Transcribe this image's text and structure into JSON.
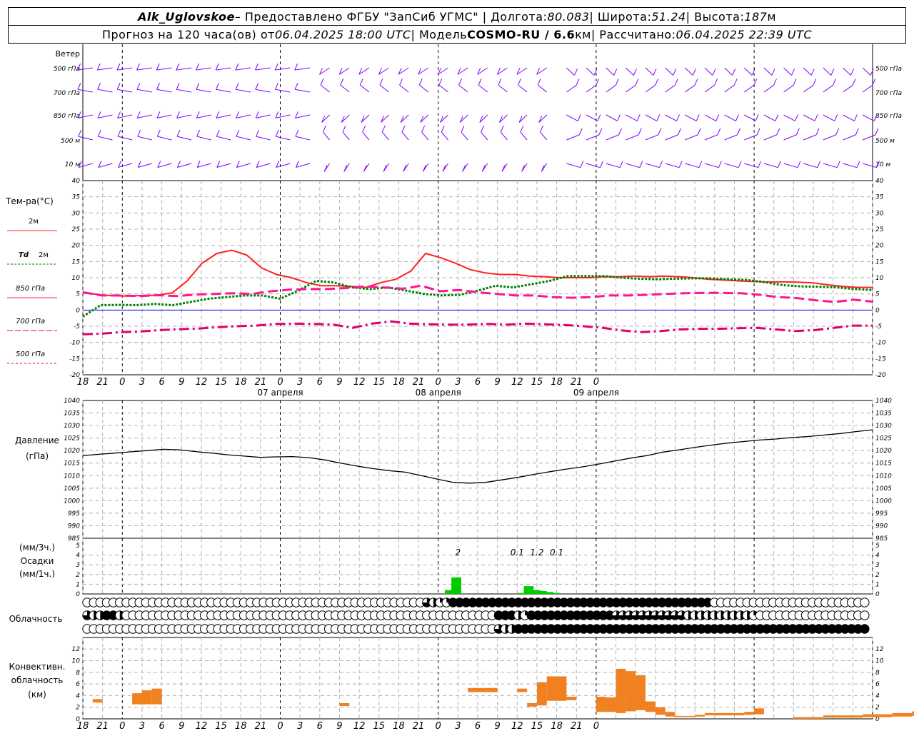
{
  "header": {
    "station": "Alk_Uglovskoe",
    "provider": " – Предоставлено ФГБУ \"ЗапСиб УГМС\" | Долгота: ",
    "lon": "80.083",
    "lat_label": " | Широта: ",
    "lat": "51.24",
    "alt_label": " | Высота: ",
    "alt": "187",
    "alt_unit": "м",
    "forecast_label": "Прогноз на 120 часа(ов) от ",
    "forecast_start": "06.04.2025 18:00 UTC",
    "model_label": "  | Модель ",
    "model": "COSMO-RU / 6.6",
    "model_unit": "км",
    "computed_label": " | Рассчитано: ",
    "computed": "06.04.2025 22:39 UTC"
  },
  "labels": {
    "wind": "Ветер",
    "wind_levels": [
      "500 гПа",
      "700 гПа",
      "850 гПа",
      "500 м",
      "10  м"
    ],
    "temp": "Тем-ра(°C)",
    "t2m": "2м",
    "td": "Td",
    "td2": "2м",
    "t850": "850 гПа",
    "t700": "700 гПа",
    "t500": "500 гПа",
    "pressure": "Давление",
    "pressure_unit": "(гПа)",
    "precip_unit3": "(мм/3ч.)",
    "precip": "Осадки",
    "precip_unit1": "(мм/1ч.)",
    "cloud": "Облачность",
    "conv1": "Конвективн.",
    "conv2": "облачность",
    "conv3": "(км)"
  },
  "time_axis": {
    "ticks": [
      "18",
      "21",
      "0",
      "3",
      "6",
      "9",
      "12",
      "15",
      "18",
      "21",
      "0",
      "3",
      "6",
      "9",
      "12",
      "15",
      "18",
      "21",
      "0",
      "3",
      "6",
      "9",
      "12",
      "15",
      "18",
      "21",
      "0"
    ],
    "dates": [
      "07 апреля",
      "08 апреля",
      "09 апреля"
    ]
  },
  "colors": {
    "wind": "#8000ff",
    "t2m": "#ff2020",
    "td": "#008000",
    "t850": "#ff1493",
    "t700": "#e0006a",
    "zero": "#0000ff",
    "precip": "#00cc00",
    "conv": "#f08020",
    "grid": "#b0b0b0"
  },
  "chart_data": [
    {
      "type": "line",
      "title": "Тем-ра(°C)",
      "x_hours": [
        0,
        3,
        6,
        9,
        12,
        15,
        18,
        21,
        24,
        27,
        30,
        33,
        36,
        39,
        42,
        45,
        48,
        51,
        54,
        57,
        60,
        63,
        66,
        69,
        72,
        75,
        78,
        81,
        84,
        87,
        90,
        93,
        96,
        99,
        102,
        105,
        108,
        111,
        114,
        117,
        120
      ],
      "ylim": [
        -20,
        40
      ],
      "series": [
        {
          "name": "2м",
          "values": [
            5.5,
            4.8,
            4.4,
            4.3,
            4.5,
            4.6,
            5.3,
            9,
            14.5,
            17.5,
            18.5,
            17,
            13,
            11,
            10,
            8.5,
            7.5,
            7.5,
            7.3,
            7,
            8.5,
            9.5,
            12,
            17.5,
            16.2,
            14.5,
            12.5,
            11.5,
            11,
            11,
            10.5,
            10.3,
            10,
            10,
            10,
            10.3,
            10.3,
            10.5,
            10.3,
            10.5,
            10.3,
            10,
            9.5,
            9.3,
            9,
            8.8,
            8.7,
            8.7,
            8.6,
            8.4,
            7.8,
            7.3,
            7,
            7
          ]
        },
        {
          "name": "Td 2м",
          "values": [
            -2,
            1.5,
            1.6,
            1.5,
            1.9,
            1.5,
            2.5,
            3.5,
            4,
            4.5,
            4.5,
            3.5,
            6,
            9,
            8.5,
            7,
            6.5,
            7,
            6,
            5,
            4.5,
            4.7,
            6,
            7.5,
            7,
            8,
            9,
            10.5,
            10.5,
            10.5,
            10,
            9.7,
            9.5,
            9.7,
            9.8,
            9.8,
            9.5,
            9.3,
            8.6,
            7.7,
            7.3,
            7.2,
            7,
            6.5,
            6.2
          ]
        },
        {
          "name": "850 гПа",
          "values": [
            5.5,
            4.5,
            4.5,
            4.3,
            4.6,
            4.3,
            4.8,
            5,
            5.2,
            5,
            5.8,
            6.3,
            6.5,
            6.5,
            6.8,
            7.3,
            7,
            6.6,
            7.5,
            5.8,
            6.2,
            5.5,
            5,
            4.5,
            4.5,
            4,
            3.8,
            4,
            4.5,
            4.5,
            4.7,
            5,
            5.2,
            5.3,
            5.3,
            5.2,
            4.7,
            4,
            3.7,
            3,
            2.5,
            3.2,
            2.6
          ]
        },
        {
          "name": "700 гПа",
          "values": [
            -7.5,
            -7.3,
            -6.8,
            -6.6,
            -6.2,
            -5.9,
            -5.7,
            -5.3,
            -5,
            -4.8,
            -4.3,
            -4.2,
            -4.3,
            -4.5,
            -5.5,
            -4.2,
            -3.5,
            -4.2,
            -4.4,
            -4.5,
            -4.5,
            -4.3,
            -4.5,
            -4.2,
            -4.4,
            -4.6,
            -5,
            -5.5,
            -6.3,
            -6.8,
            -6.5,
            -6,
            -5.8,
            -5.8,
            -5.6,
            -5.5,
            -6,
            -6.5,
            -6.2,
            -5.5,
            -4.8,
            -4.8
          ]
        }
      ]
    },
    {
      "type": "line",
      "title": "Давление",
      "ylabel": "(гПа)",
      "ylim": [
        985,
        1040
      ],
      "series": [
        {
          "name": "Давление",
          "values": [
            1018,
            1018.5,
            1019,
            1019.5,
            1020,
            1020.5,
            1020.3,
            1019.6,
            1019,
            1018.3,
            1017.8,
            1017.3,
            1017.5,
            1017.6,
            1017.2,
            1016.3,
            1015,
            1013.8,
            1012.8,
            1012,
            1011.4,
            1010,
            1008.6,
            1007.3,
            1007,
            1007.3,
            1008.3,
            1009.3,
            1010.5,
            1011.6,
            1012.6,
            1013.5,
            1014.6,
            1015.8,
            1017,
            1018,
            1019.4,
            1020.3,
            1021.3,
            1022.2,
            1023,
            1023.6,
            1024.2,
            1024.6,
            1025.2,
            1025.6,
            1026.2,
            1026.8,
            1027.6,
            1028.3
          ]
        }
      ]
    },
    {
      "type": "bar",
      "title": "Осадки",
      "ylabel": "(мм/1ч.)",
      "ylim": [
        0,
        5
      ],
      "annotations": [
        {
          "x_hour": 57,
          "text": "2"
        },
        {
          "x_hour": 66,
          "text": "0.1"
        },
        {
          "x_hour": 69,
          "text": "1.2"
        },
        {
          "x_hour": 72,
          "text": "0.1"
        }
      ],
      "bars": [
        {
          "x_hour": 55,
          "value": 0.4
        },
        {
          "x_hour": 56,
          "value": 1.7
        },
        {
          "x_hour": 66,
          "value": 0.1
        },
        {
          "x_hour": 67,
          "value": 0.8
        },
        {
          "x_hour": 68,
          "value": 0.4
        },
        {
          "x_hour": 69,
          "value": 0.3
        },
        {
          "x_hour": 70,
          "value": 0.2
        },
        {
          "x_hour": 71,
          "value": 0.1
        }
      ]
    },
    {
      "type": "bar",
      "title": "Конвективн. облачность",
      "ylabel": "(км)",
      "ylim": [
        0,
        13
      ],
      "bars": [
        {
          "x0": 1,
          "x1": 2,
          "bottom": 2.8,
          "top": 3.4
        },
        {
          "x0": 5,
          "x1": 6,
          "bottom": 2.5,
          "top": 4.4
        },
        {
          "x0": 6,
          "x1": 7,
          "bottom": 2.5,
          "top": 4.9
        },
        {
          "x0": 7,
          "x1": 8,
          "bottom": 2.5,
          "top": 5.2
        },
        {
          "x0": 26,
          "x1": 27,
          "bottom": 2.2,
          "top": 2.7
        },
        {
          "x0": 39,
          "x1": 42,
          "bottom": 4.6,
          "top": 5.3
        },
        {
          "x0": 44,
          "x1": 45,
          "bottom": 4.6,
          "top": 5.2
        },
        {
          "x0": 45,
          "x1": 46,
          "bottom": 2.1,
          "top": 2.7
        },
        {
          "x0": 46,
          "x1": 47,
          "bottom": 2.3,
          "top": 6.3
        },
        {
          "x0": 47,
          "x1": 49,
          "bottom": 3.1,
          "top": 7.3
        },
        {
          "x0": 49,
          "x1": 50,
          "bottom": 3.2,
          "top": 3.8
        },
        {
          "x0": 52,
          "x1": 53,
          "bottom": 1.2,
          "top": 3.8
        },
        {
          "x0": 53,
          "x1": 54,
          "bottom": 1.2,
          "top": 3.7
        },
        {
          "x0": 54,
          "x1": 55,
          "bottom": 1.0,
          "top": 8.6
        },
        {
          "x0": 55,
          "x1": 56,
          "bottom": 1.3,
          "top": 8.2
        },
        {
          "x0": 56,
          "x1": 57,
          "bottom": 1.5,
          "top": 7.5
        },
        {
          "x0": 57,
          "x1": 58,
          "bottom": 1.2,
          "top": 3.0
        },
        {
          "x0": 58,
          "x1": 59,
          "bottom": 0.7,
          "top": 2.0
        },
        {
          "x0": 59,
          "x1": 60,
          "bottom": 0.4,
          "top": 1.2
        },
        {
          "x0": 60,
          "x1": 62,
          "bottom": 0.3,
          "top": 0.5
        },
        {
          "x0": 62,
          "x1": 63,
          "bottom": 0.4,
          "top": 0.7
        },
        {
          "x0": 63,
          "x1": 64,
          "bottom": 0.6,
          "top": 1.0
        },
        {
          "x0": 64,
          "x1": 67,
          "bottom": 0.6,
          "top": 1.0
        },
        {
          "x0": 67,
          "x1": 68,
          "bottom": 0.7,
          "top": 1.2
        },
        {
          "x0": 68,
          "x1": 69,
          "bottom": 0.8,
          "top": 1.8
        },
        {
          "x0": 72,
          "x1": 75,
          "bottom": 0.0,
          "top": 0.3
        },
        {
          "x0": 75,
          "x1": 79,
          "bottom": 0.2,
          "top": 0.6
        },
        {
          "x0": 79,
          "x1": 82,
          "bottom": 0.3,
          "top": 0.8
        },
        {
          "x0": 82,
          "x1": 84,
          "bottom": 0.4,
          "top": 1.0
        },
        {
          "x0": 84,
          "x1": 87,
          "bottom": 0.5,
          "top": 1.3
        },
        {
          "x0": 87,
          "x1": 89,
          "bottom": 0.6,
          "top": 1.5
        },
        {
          "x0": 96,
          "x1": 98,
          "bottom": 1.3,
          "top": 1.8
        },
        {
          "x0": 99,
          "x1": 101,
          "bottom": 1.2,
          "top": 1.7
        }
      ]
    }
  ],
  "clouds": {
    "legend": "0=clear, 1=quarter, 2=half, 3=three-quarter, 4=overcast",
    "rows": [
      "0000000000000000000000000000000000000000000000000000321144444444444444444444444444444444444444440000000000000000000000000",
      "3224420000000000000000000000000000000000000000000000000000000004442144444444444443333333333322222222221000000000000000000",
      "0000000000000000000000000000000000000000000000000000000000000003224444444444444444444444444444444444444444444444444444444"
    ]
  }
}
